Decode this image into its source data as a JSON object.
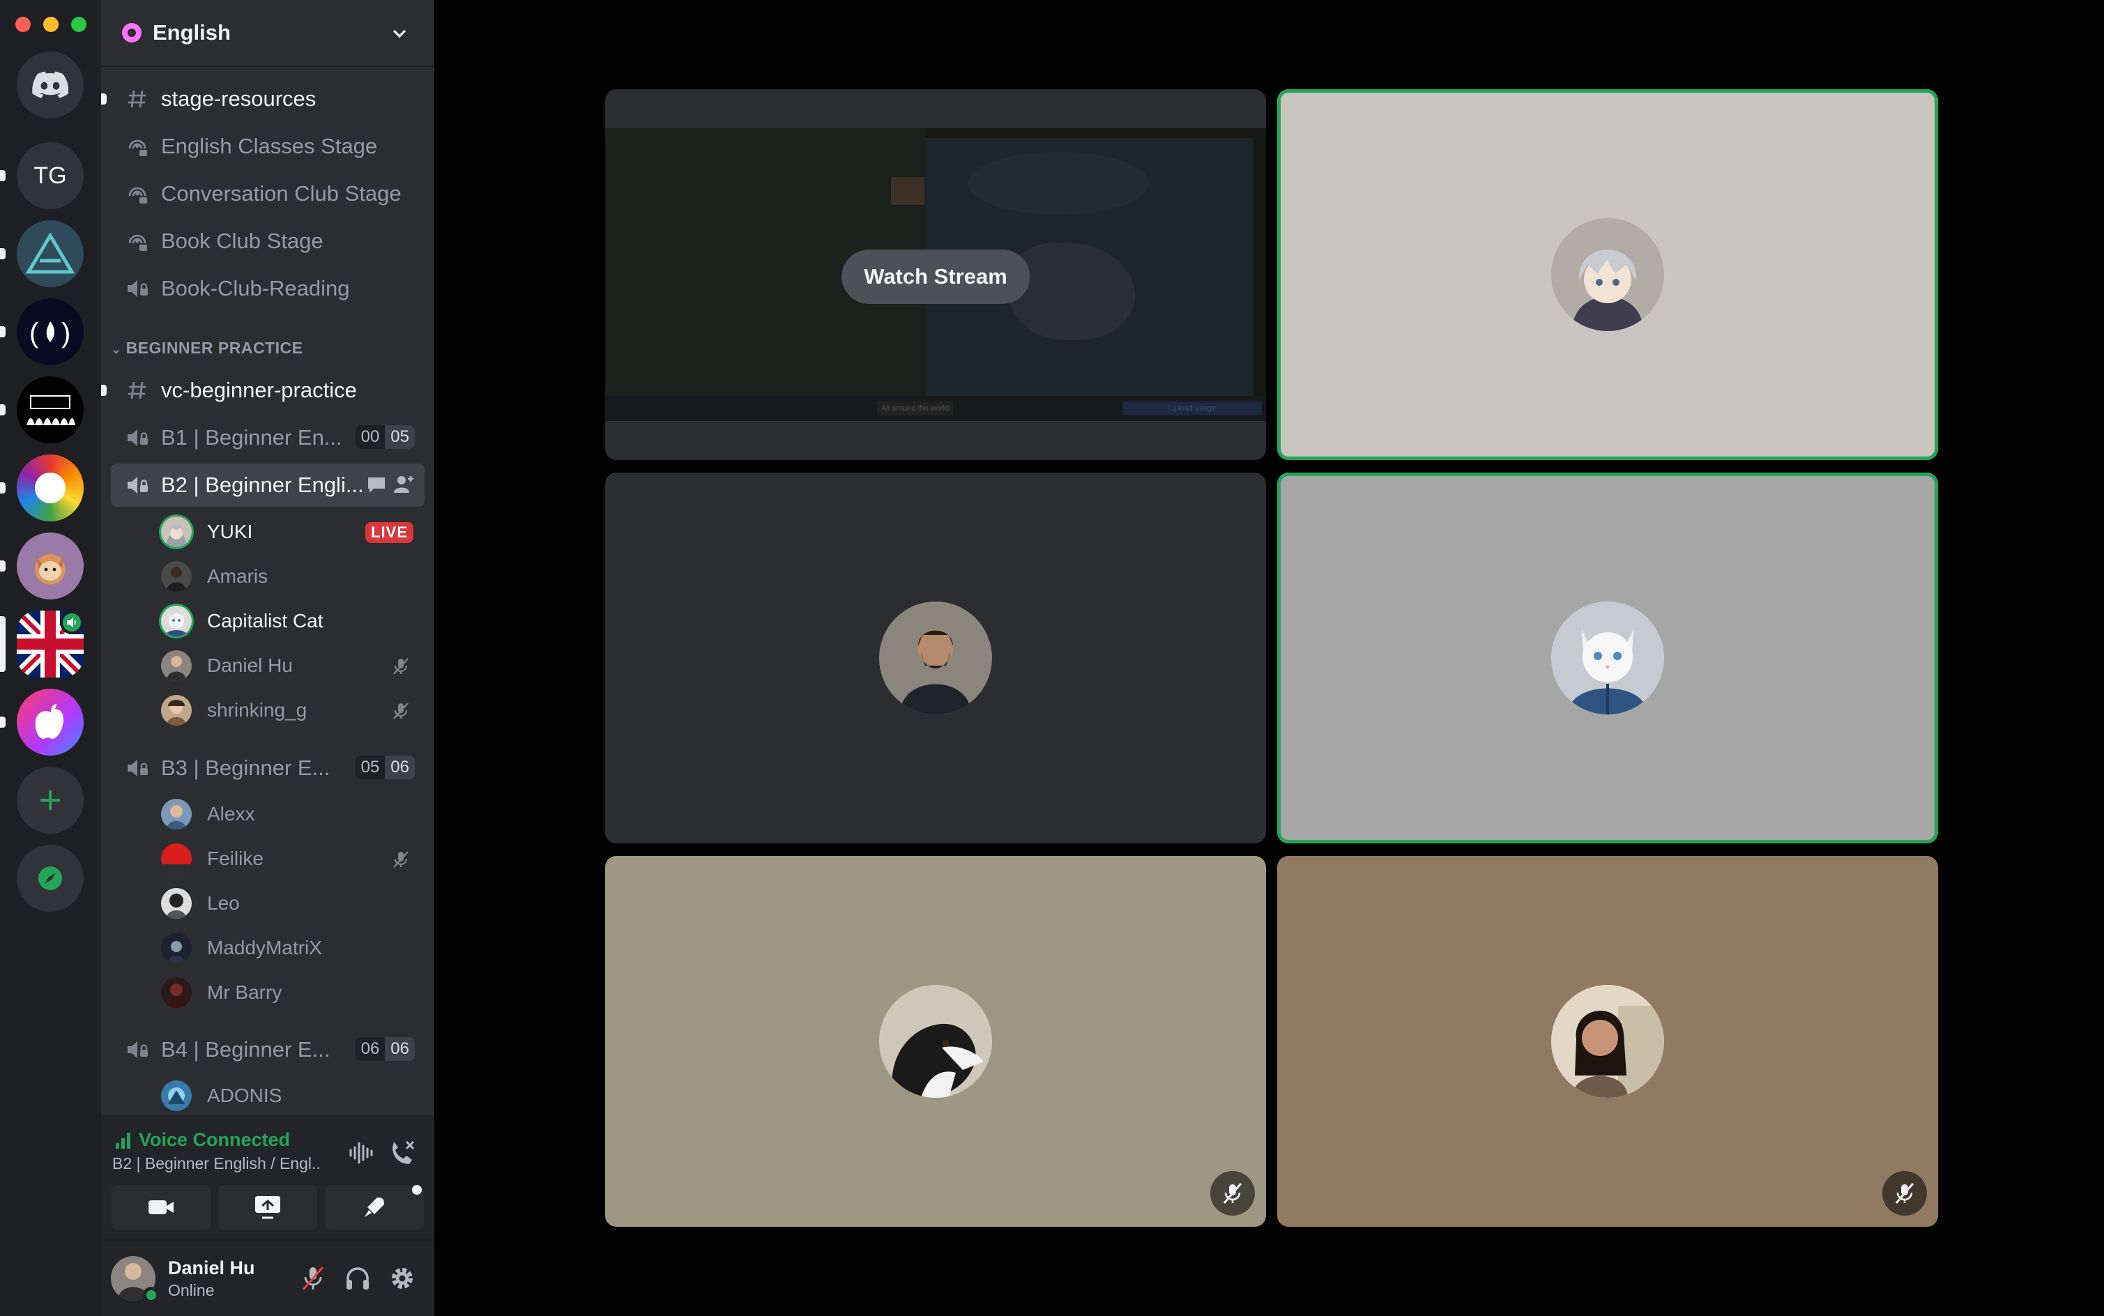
{
  "guild": {
    "name": "English"
  },
  "rail": {
    "servers": [
      {
        "name": "Direct Messages"
      },
      {
        "initials": "TG"
      },
      {
        "name": "A server"
      },
      {
        "name": "freeCodeCamp"
      },
      {
        "name": "Community"
      },
      {
        "name": "Rainbow"
      },
      {
        "name": "Corgi"
      },
      {
        "name": "English"
      },
      {
        "name": "Apple"
      }
    ]
  },
  "channels": {
    "stage_resources": "stage-resources",
    "english_classes_stage": "English Classes Stage",
    "conversation_club_stage": "Conversation Club Stage",
    "book_club_stage": "Book Club Stage",
    "book_club_reading": "Book-Club-Reading",
    "category_beginner": "BEGINNER PRACTICE",
    "vc_beginner_practice": "vc-beginner-practice",
    "b1": {
      "name": "B1 | Beginner En...",
      "count": "00",
      "limit": "05"
    },
    "b2": {
      "name": "B2 | Beginner Engli..."
    },
    "b3": {
      "name": "B3 | Beginner E...",
      "count": "05",
      "limit": "06"
    },
    "b4": {
      "name": "B4 | Beginner E...",
      "count": "06",
      "limit": "06"
    }
  },
  "b2_users": [
    {
      "name": "YUKI",
      "badge": "LIVE"
    },
    {
      "name": "Amaris"
    },
    {
      "name": "Capitalist Cat"
    },
    {
      "name": "Daniel Hu"
    },
    {
      "name": "shrinking_g"
    }
  ],
  "b3_users": [
    {
      "name": "Alexx"
    },
    {
      "name": "Feilike"
    },
    {
      "name": "Leo"
    },
    {
      "name": "MaddyMatriX"
    },
    {
      "name": "Mr Barry"
    }
  ],
  "b4_users": [
    {
      "name": "ADONIS"
    }
  ],
  "voice": {
    "status": "Voice Connected",
    "channel": "B2 | Beginner English / Engl..."
  },
  "user": {
    "name": "Daniel Hu",
    "status": "Online"
  },
  "stage": {
    "watch_stream": "Watch Stream",
    "stream_stats": "All around the world",
    "stream_badge": "Upload usage",
    "tiles": [
      {
        "name": "YUKI",
        "state": "stream"
      },
      {
        "name": "YUKI",
        "state": "speaking"
      },
      {
        "name": "Amaris",
        "state": "idle"
      },
      {
        "name": "Capitalist Cat",
        "state": "speaking"
      },
      {
        "name": "dog",
        "state": "muted"
      },
      {
        "name": "woman",
        "state": "muted"
      }
    ]
  },
  "colors": {
    "accent_green": "#23a55a",
    "live_red": "#da373c",
    "sidebar": "#2b2d31",
    "rail": "#1e1f22"
  }
}
